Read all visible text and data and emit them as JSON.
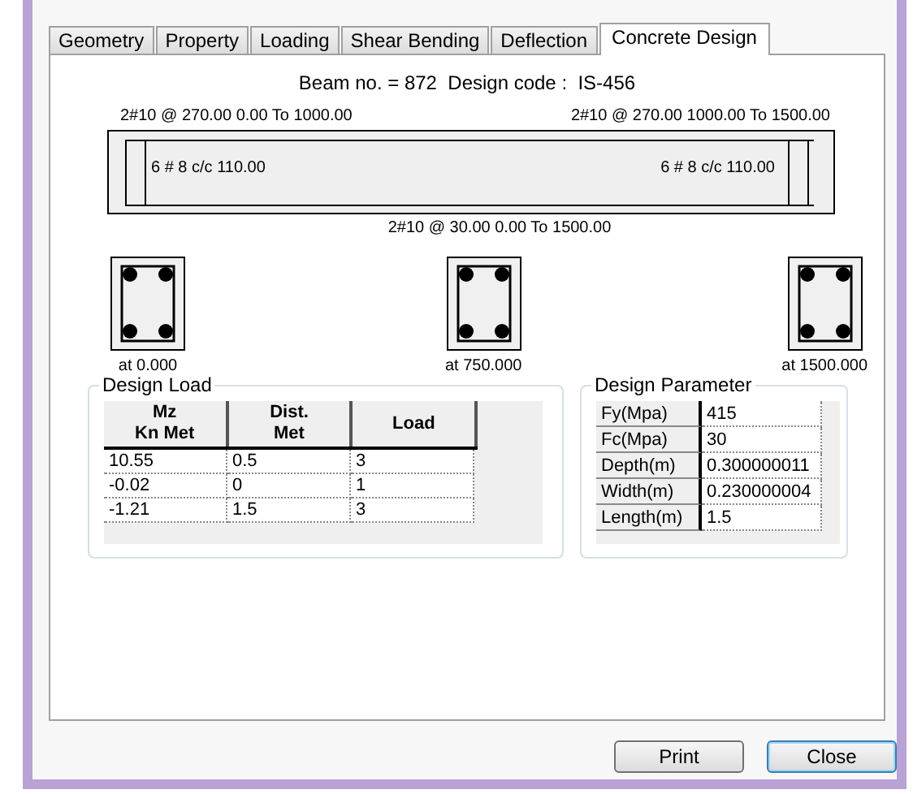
{
  "tabs": [
    {
      "label": "Geometry",
      "selected": false
    },
    {
      "label": "Property",
      "selected": false
    },
    {
      "label": "Loading",
      "selected": false
    },
    {
      "label": "Shear Bending",
      "selected": false
    },
    {
      "label": "Deflection",
      "selected": false
    },
    {
      "label": "Concrete Design",
      "selected": true
    }
  ],
  "heading": "Beam no. = 872  Design code :  IS-456",
  "top_bars": [
    "2#10 @ 270.00 0.00 To 1000.00",
    "2#10 @ 270.00 1000.00 To 1500.00"
  ],
  "stirrups": [
    "6 # 8 c/c 110.00",
    "6 # 8 c/c 110.00"
  ],
  "bottom_bar": "2#10 @ 30.00 0.00 To 1500.00",
  "sections": [
    {
      "label": "at 0.000"
    },
    {
      "label": "at 750.000"
    },
    {
      "label": "at 1500.000"
    }
  ],
  "design_load": {
    "title": "Design Load",
    "columns": [
      "Mz\nKn Met",
      "Dist.\nMet",
      "Load"
    ],
    "rows": [
      [
        "10.55",
        "0.5",
        "3"
      ],
      [
        "-0.02",
        "0",
        "1"
      ],
      [
        "-1.21",
        "1.5",
        "3"
      ]
    ]
  },
  "design_parameter": {
    "title": "Design Parameter",
    "rows": [
      {
        "name": "Fy(Mpa)",
        "value": "415"
      },
      {
        "name": "Fc(Mpa)",
        "value": "30"
      },
      {
        "name": "Depth(m)",
        "value": "0.300000011"
      },
      {
        "name": "Width(m)",
        "value": "0.230000004"
      },
      {
        "name": "Length(m)",
        "value": "1.5"
      }
    ]
  },
  "buttons": [
    {
      "label": "Print",
      "default": false
    },
    {
      "label": "Close",
      "default": true
    }
  ]
}
